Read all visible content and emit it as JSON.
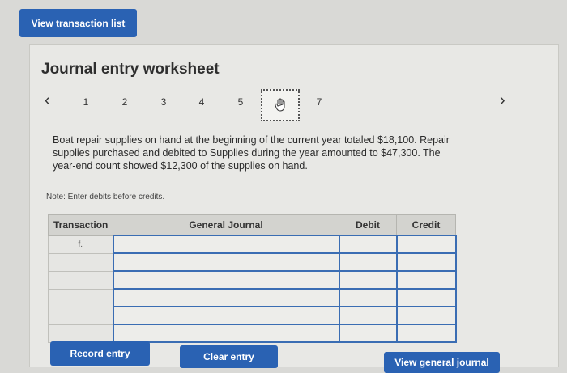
{
  "header": {
    "view_list_label": "View transaction list"
  },
  "worksheet": {
    "title": "Journal entry worksheet",
    "prev_icon": "chevron-left-icon",
    "next_icon": "chevron-right-icon",
    "steps": [
      "1",
      "2",
      "3",
      "4",
      "5",
      "6",
      "7"
    ],
    "active_step": "6",
    "active_step_icon": "hand-cursor-icon"
  },
  "question": {
    "text": "Boat repair supplies on hand at the beginning of the current year totaled $18,100. Repair supplies purchased and debited to Supplies during the year amounted to $47,300. The year-end count showed $12,300 of the supplies on hand."
  },
  "note": "Note: Enter debits before credits.",
  "table": {
    "headers": {
      "transaction": "Transaction",
      "general_journal": "General Journal",
      "debit": "Debit",
      "credit": "Credit"
    },
    "rows": [
      {
        "transaction": "f."
      },
      {
        "transaction": ""
      },
      {
        "transaction": ""
      },
      {
        "transaction": ""
      },
      {
        "transaction": ""
      },
      {
        "transaction": ""
      }
    ]
  },
  "buttons": {
    "record": "Record entry",
    "clear": "Clear entry",
    "view_general_journal": "View general journal"
  },
  "colors": {
    "accent": "#2a62b3",
    "background": "#d9d9d6",
    "panel": "#e8e8e5"
  }
}
